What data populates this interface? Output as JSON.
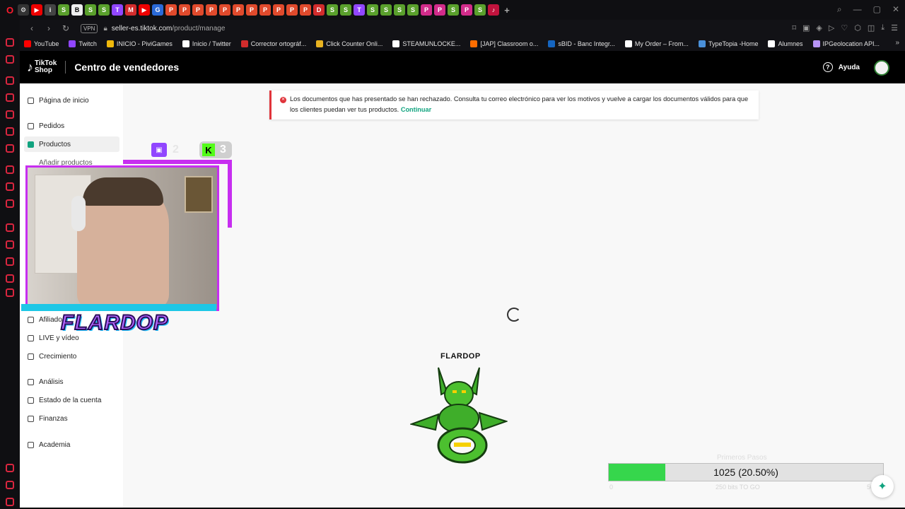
{
  "browser": {
    "url_host": "seller-es.tiktok.com",
    "url_path": "/product/manage",
    "vpn_label": "VPN",
    "bookmarks": [
      {
        "label": "YouTube",
        "color": "#ff0000"
      },
      {
        "label": "Twitch",
        "color": "#9146ff"
      },
      {
        "label": "INICIO - PiviGames",
        "color": "#f0b90b"
      },
      {
        "label": "Inicio / Twitter",
        "color": "#ffffff"
      },
      {
        "label": "Corrector ortográf...",
        "color": "#d22c2c"
      },
      {
        "label": "Click Counter Onli...",
        "color": "#e9b321"
      },
      {
        "label": "STEAMUNLOCKE...",
        "color": "#ffffff"
      },
      {
        "label": "[JAP] Classroom o...",
        "color": "#ff6d00"
      },
      {
        "label": "sBID - Banc Integr...",
        "color": "#1565c0"
      },
      {
        "label": "My Order – From...",
        "color": "#ffffff"
      },
      {
        "label": "TypeTopia -Home",
        "color": "#4a90d9"
      },
      {
        "label": "Alumnes",
        "color": "#ffffff"
      },
      {
        "label": "IPGeolocation API...",
        "color": "#b794f6"
      }
    ]
  },
  "header": {
    "brand_line1": "TikTok",
    "brand_line2": "Shop",
    "title": "Centro de vendedores",
    "help_label": "Ayuda"
  },
  "sidebar": {
    "home": "Página de inicio",
    "orders": "Pedidos",
    "products": "Productos",
    "add_products": "Añadir productos",
    "affiliates": "Afiliado",
    "live_video": "LIVE y vídeo",
    "growth": "Crecimiento",
    "analytics": "Análisis",
    "account_status": "Estado de la cuenta",
    "finances": "Finanzas",
    "academy": "Academia"
  },
  "alert": {
    "message": "Los documentos que has presentado se han rechazado. Consulta tu correo electrónico para ver los motivos y vuelve a cargar los documentos válidos para que los clientes puedan ver tus productos.",
    "link": "Continuar"
  },
  "overlay": {
    "streamer_name": "FLARDOP",
    "twitch_viewers": "2",
    "kick_viewers": "3",
    "game_label": "FLARDOP",
    "goal_title": "Primeros Pasos",
    "goal_progress_text": "1025 (20.50%)",
    "goal_fraction": 0.205,
    "goal_min": "0",
    "goal_sub": "250 bits TO GO",
    "goal_max": "5000"
  },
  "colors": {
    "accent": "#11a37f",
    "alert": "#e0343b",
    "progress": "#36d64c",
    "overlay_frame": "#c72ef0"
  }
}
